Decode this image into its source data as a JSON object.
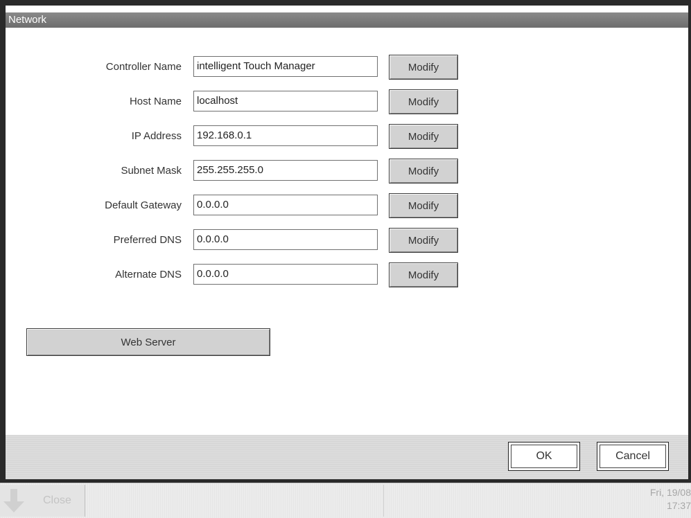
{
  "window": {
    "title": "Network"
  },
  "fields": [
    {
      "label": "Controller Name",
      "value": "intelligent Touch Manager",
      "button": "Modify"
    },
    {
      "label": "Host Name",
      "value": "localhost",
      "button": "Modify"
    },
    {
      "label": "IP Address",
      "value": "192.168.0.1",
      "button": "Modify"
    },
    {
      "label": "Subnet Mask",
      "value": "255.255.255.0",
      "button": "Modify"
    },
    {
      "label": "Default Gateway",
      "value": "0.0.0.0",
      "button": "Modify"
    },
    {
      "label": "Preferred DNS",
      "value": "0.0.0.0",
      "button": "Modify"
    },
    {
      "label": "Alternate DNS",
      "value": "0.0.0.0",
      "button": "Modify"
    }
  ],
  "web_server_button": "Web Server",
  "footer": {
    "ok": "OK",
    "cancel": "Cancel"
  },
  "taskbar": {
    "close_label": "Close",
    "close_icon": "down-arrow-icon",
    "date": "Fri, 19/08",
    "time": "17:37"
  }
}
